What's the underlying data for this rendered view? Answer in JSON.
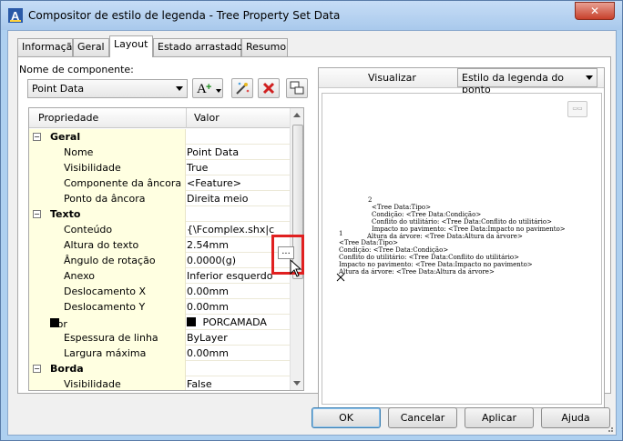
{
  "window": {
    "title": "Compositor de estilo de legenda - Tree Property Set Data",
    "close_label": "✕"
  },
  "tabs": [
    {
      "label": "Informação",
      "active": false
    },
    {
      "label": "Geral",
      "active": false
    },
    {
      "label": "Layout",
      "active": true
    },
    {
      "label": "Estado arrastado",
      "active": false
    },
    {
      "label": "Resumo",
      "active": false
    }
  ],
  "component": {
    "label": "Nome de componente:",
    "value": "Point Data"
  },
  "toolbar": {
    "add_text_icon": "A+",
    "edit_icon": "magic-wand",
    "delete_icon": "✖",
    "order_icon": "component-order"
  },
  "grid": {
    "headers": {
      "property": "Propriedade",
      "value": "Valor"
    },
    "rows": [
      {
        "type": "category",
        "label": "Geral",
        "expander": "⊟"
      },
      {
        "type": "prop",
        "label": "Nome",
        "value": "Point Data"
      },
      {
        "type": "prop",
        "label": "Visibilidade",
        "value": "True"
      },
      {
        "type": "prop",
        "label": "Componente da âncora",
        "value": "<Feature>"
      },
      {
        "type": "prop",
        "label": "Ponto da âncora",
        "value": "Direita meio"
      },
      {
        "type": "category",
        "label": "Texto",
        "expander": "⊟"
      },
      {
        "type": "prop",
        "label": "Conteúdo",
        "value": "{\\Fcomplex.shx|c0"
      },
      {
        "type": "prop",
        "label": "Altura do texto",
        "value": "2.54mm"
      },
      {
        "type": "prop",
        "label": "Ângulo de rotação",
        "value": "0.0000(g)"
      },
      {
        "type": "prop",
        "label": "Anexo",
        "value": "Inferior esquerdo"
      },
      {
        "type": "prop",
        "label": "Deslocamento X",
        "value": "0.00mm"
      },
      {
        "type": "prop",
        "label": "Deslocamento Y",
        "value": "0.00mm"
      },
      {
        "type": "prop",
        "label": "Cor",
        "value": "PORCAMADA",
        "color": "#000000"
      },
      {
        "type": "prop",
        "label": "Espessura de linha",
        "value": "ByLayer"
      },
      {
        "type": "prop",
        "label": "Largura máxima",
        "value": "0.00mm"
      },
      {
        "type": "category",
        "label": "Borda",
        "expander": "⊟"
      },
      {
        "type": "prop",
        "label": "Visibilidade",
        "value": "False"
      }
    ],
    "ellipsis_label": "..."
  },
  "preview": {
    "label": "Visualizar",
    "style_value": "Estilo da legenda do ponto",
    "text_lines_1": [
      "2",
      "<Tree Data:Tipo>",
      "Condição: <Tree Data:Condição>",
      "Conflito do utilitário: <Tree Data:Conflito do utilitário>",
      "Impacto no pavimento: <Tree Data:Impacto no pavimento>",
      "Altura da árvore: <Tree Data:Altura da árvore>"
    ],
    "marker_label": "1",
    "text_lines_2": [
      "<Tree Data:Tipo>",
      "Condição: <Tree Data:Condição>",
      "Conflito do utilitário: <Tree Data:Conflito do utilitário>",
      "Impacto no pavimento: <Tree Data:Impacto no pavimento>",
      "Altura da árvore: <Tree Data:Altura da árvore>"
    ]
  },
  "buttons": {
    "ok": "OK",
    "cancel": "Cancelar",
    "apply": "Aplicar",
    "help": "Ajuda"
  }
}
